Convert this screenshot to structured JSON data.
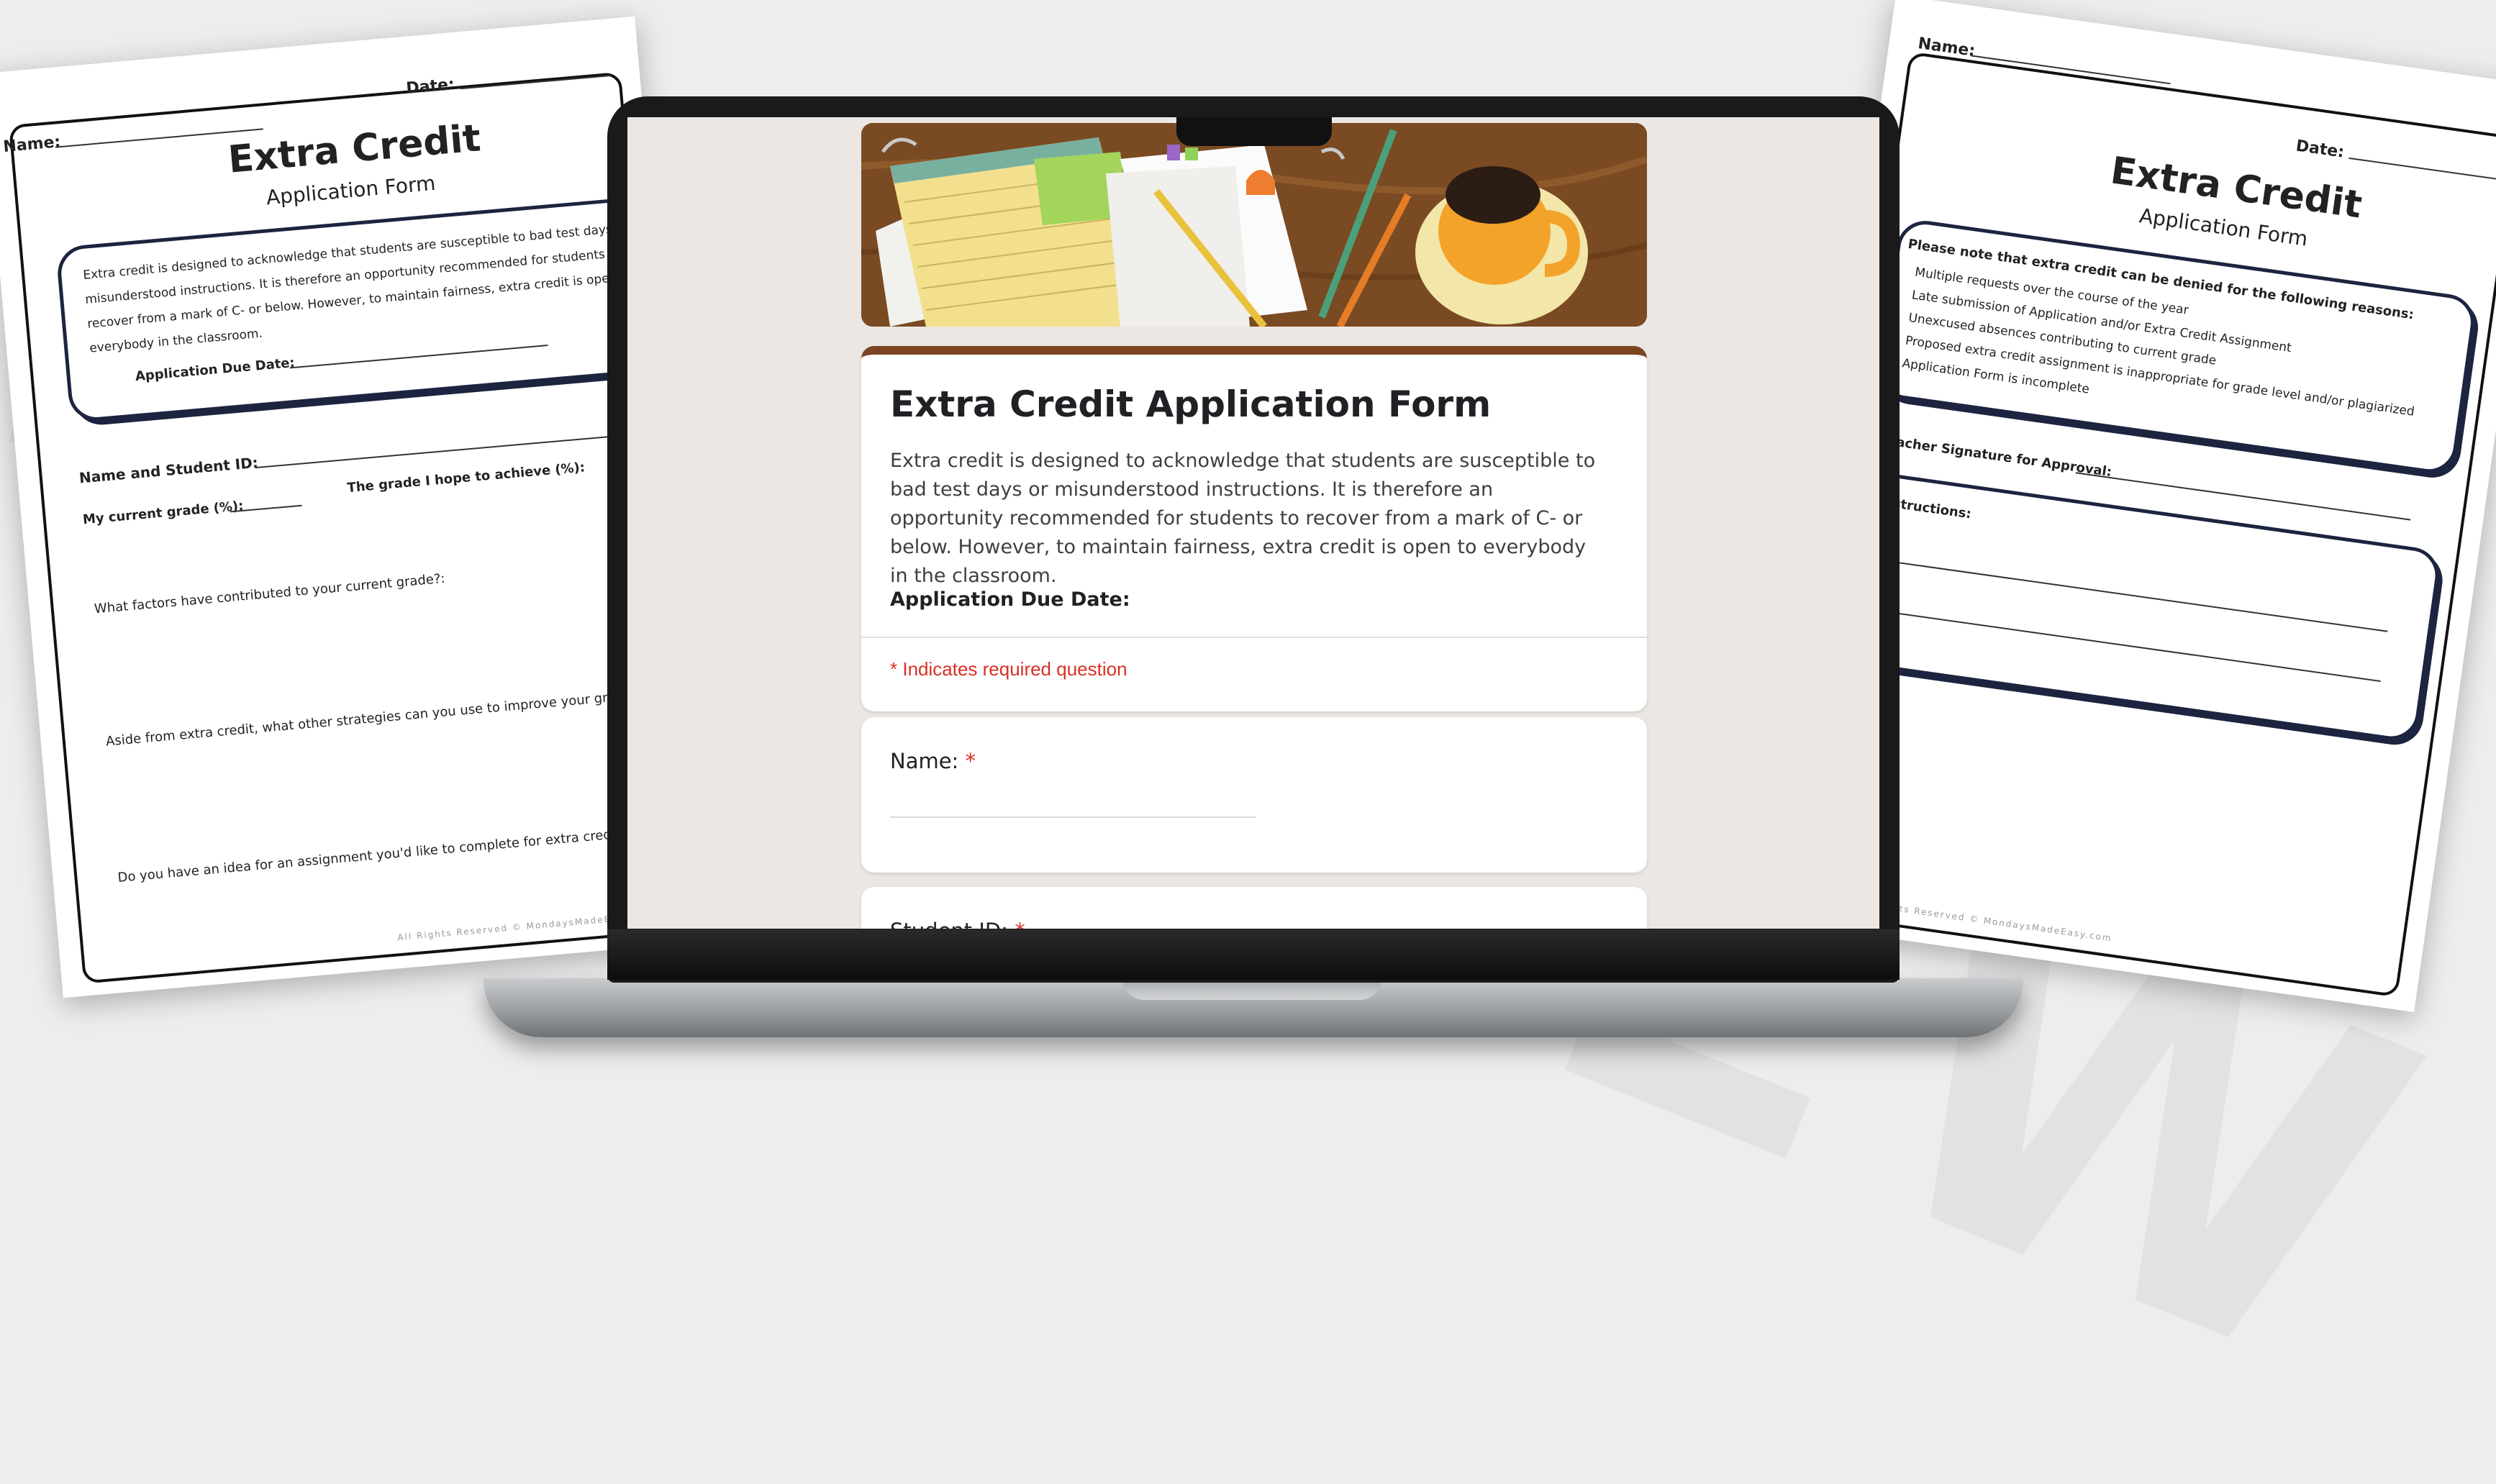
{
  "watermark": "PREVIEW",
  "left_page": {
    "name_label": "Name:",
    "date_label": "Date:",
    "title": "Extra Credit",
    "subtitle": "Application Form",
    "intro_lines": [
      "Extra credit is designed to acknowledge that students are susceptible to bad test days or",
      "misunderstood instructions. It is therefore an opportunity recommended for students to",
      "recover from a mark of C- or below. However, to maintain fairness, extra credit is open to",
      "everybody in the classroom."
    ],
    "due_label": "Application Due Date:",
    "name_id_label": "Name and Student ID:",
    "hope_label": "The grade I hope to achieve (%):",
    "current_label": "My current grade (%):",
    "q1": "What factors have contributed to your current grade?:",
    "q2": "Aside from extra credit, what other strategies can you use to improve your grade?",
    "q3": "Do you have an idea for an assignment you'd like to complete for extra credit?",
    "footer": "All Rights Reserved © MondaysMadeEasy.com"
  },
  "right_page": {
    "name_label": "Name:",
    "date_label": "Date:",
    "title": "Extra Credit",
    "subtitle": "Application Form",
    "note_heading": "Please note that extra credit can be denied for the following reasons:",
    "reasons": [
      "Multiple requests over the course of the year",
      "Late submission of Application and/or Extra Credit Assignment",
      "Unexcused absences contributing to current grade",
      "Proposed extra credit assignment is inappropriate for grade level and/or plagiarized",
      "Application Form is incomplete"
    ],
    "signature_label": "Teacher Signature for Approval:",
    "instructions_label": "Instructions:",
    "footer": "All Rights Reserved © MondaysMadeEasy.com"
  },
  "form": {
    "title": "Extra Credit Application Form",
    "description": "Extra credit is designed to acknowledge that students are susceptible to bad test days or misunderstood instructions. It is therefore an opportunity recommended for students to recover from a mark of C- or below. However, to maintain fairness, extra credit is open to everybody in the classroom.",
    "due_date_label": "Application Due Date:",
    "required_note": "* Indicates required question",
    "accent_color": "#7b4524",
    "questions": [
      {
        "label": "Name:",
        "required_mark": "*"
      },
      {
        "label": "Student ID:",
        "required_mark": "*"
      }
    ]
  }
}
